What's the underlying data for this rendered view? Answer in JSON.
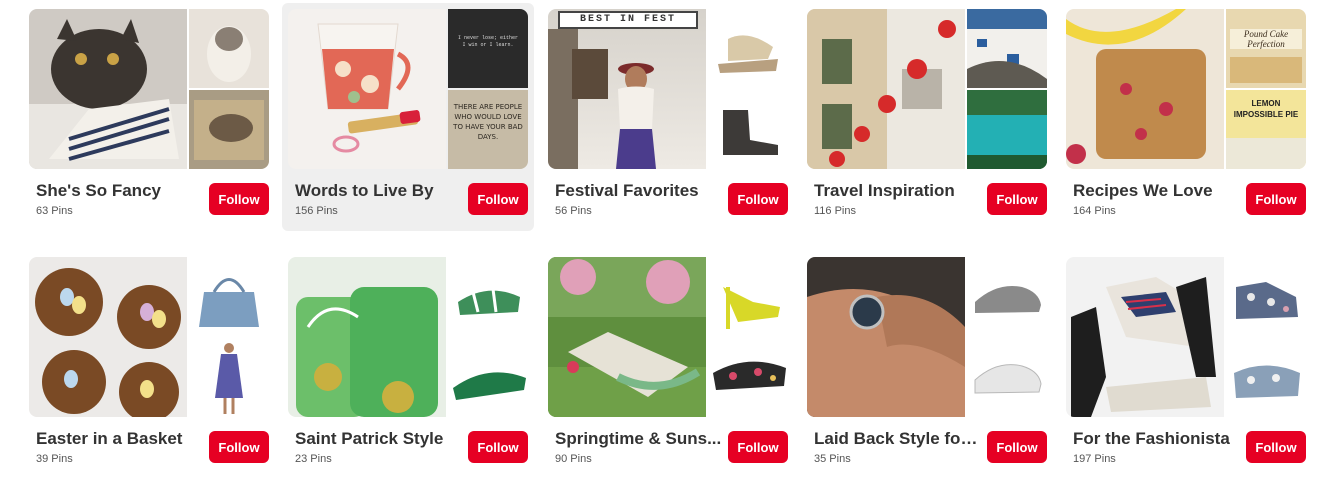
{
  "follow_label": "Follow",
  "boards": [
    {
      "title": "She's So Fancy",
      "pins": "63 Pins"
    },
    {
      "title": "Words to Live By",
      "pins": "156 Pins"
    },
    {
      "title": "Festival Favorites",
      "pins": "56 Pins"
    },
    {
      "title": "Travel Inspiration",
      "pins": "116 Pins"
    },
    {
      "title": "Recipes We Love",
      "pins": "164 Pins"
    },
    {
      "title": "Easter in a Basket",
      "pins": "39 Pins"
    },
    {
      "title": "Saint Patrick Style",
      "pins": "23 Pins"
    },
    {
      "title": "Springtime & Suns...",
      "pins": "90 Pins"
    },
    {
      "title": "Laid Back Style for ...",
      "pins": "35 Pins"
    },
    {
      "title": "For the Fashionista",
      "pins": "197 Pins"
    }
  ],
  "image_text": {
    "best_in_fest": "BEST IN FEST",
    "quote_small": "I never lose; either I win or I learn.",
    "quote_handwritten": "THERE ARE PEOPLE WHO WOULD LOVE TO HAVE YOUR BAD DAYS.",
    "pound_cake": "Pound Cake Perfection",
    "lemon_pie": "LEMON IMPOSSIBLE PIE"
  }
}
